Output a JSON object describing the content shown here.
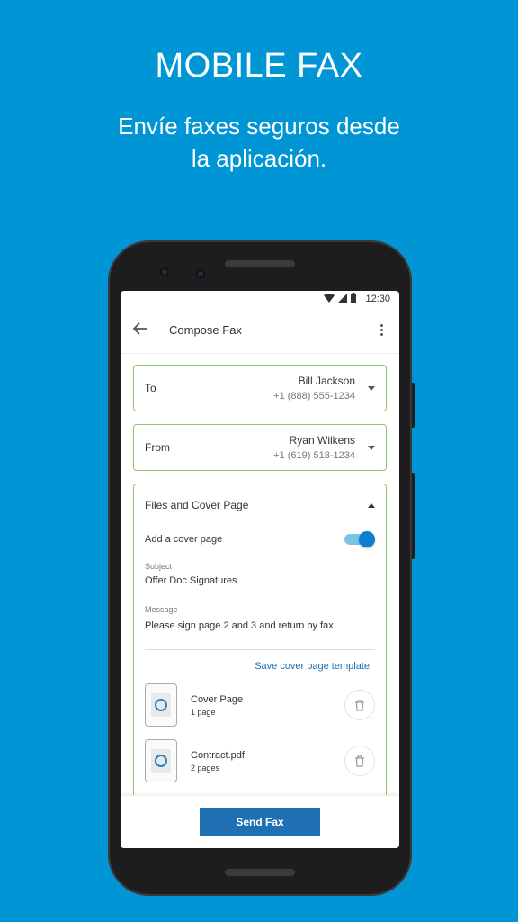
{
  "promo": {
    "headline": "MOBILE FAX",
    "subline_1": "Envíe faxes seguros desde",
    "subline_2": "la aplicación."
  },
  "statusbar": {
    "time": "12:30"
  },
  "appbar": {
    "title": "Compose Fax"
  },
  "to": {
    "label": "To",
    "name": "Bill Jackson",
    "number": "+1 (888) 555-1234"
  },
  "from": {
    "label": "From",
    "name": "Ryan Wilkens",
    "number": "+1 (619) 518-1234"
  },
  "files_section": {
    "title": "Files and Cover Page",
    "cover_toggle_label": "Add a cover page",
    "cover_enabled": true,
    "subject_label": "Subject",
    "subject_value": "Offer Doc Signatures",
    "message_label": "Message",
    "message_value": "Please sign page 2 and 3 and return by fax",
    "save_template_label": "Save cover page template",
    "files": [
      {
        "name": "Cover Page",
        "pages": "1 page"
      },
      {
        "name": "Contract.pdf",
        "pages": "2 pages"
      }
    ]
  },
  "send_label": "Send Fax",
  "colors": {
    "background": "#0096d6",
    "accent": "#1f6fb3",
    "field_border": "#8ec56a"
  }
}
